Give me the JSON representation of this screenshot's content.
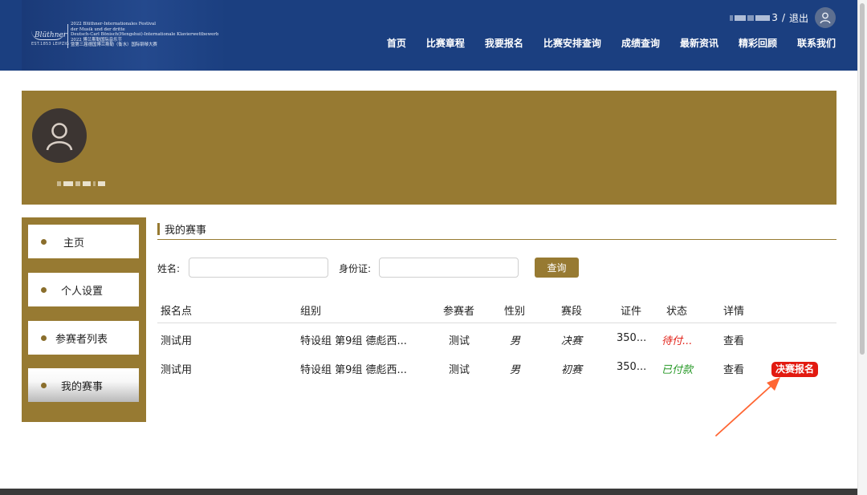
{
  "header": {
    "logo_mark": "Blüthner",
    "logo_sub": "EST.1853 LEIPZIG",
    "logo_lines": [
      "2022 Blüthner-Internationales Festival",
      "der Musik und der dritte",
      "Deutsch-Carl Bönisch(Hengshui)-Internationale Klavierwettbewerb",
      "2022 博兰斯勒国际音乐节",
      "暨第三届德国博兰斯勒（衡水）国际钢琴大赛"
    ],
    "user_suffix": "3",
    "user_sep": "/",
    "logout_label": "退出",
    "nav": [
      "首页",
      "比赛章程",
      "我要报名",
      "比赛安排查询",
      "成绩查询",
      "最新资讯",
      "精彩回顾",
      "联系我们"
    ]
  },
  "sidebar": {
    "items": [
      {
        "label": "主页"
      },
      {
        "label": "个人设置"
      },
      {
        "label": "参赛者列表"
      },
      {
        "label": "我的赛事"
      }
    ],
    "active_index": 3
  },
  "main": {
    "section_title": "我的赛事",
    "search": {
      "name_label": "姓名:",
      "name_value": "",
      "name_placeholder": "",
      "id_label": "身份证:",
      "id_value": "",
      "id_placeholder": "",
      "query_label": "查询"
    },
    "table": {
      "headers": [
        "报名点",
        "组别",
        "参赛者",
        "性别",
        "赛段",
        "证件",
        "状态",
        "详情"
      ],
      "rows": [
        {
          "site": "测试用",
          "group": "特设组 第9组 德彪西...",
          "participant": "测试",
          "gender": "男",
          "stage": "决赛",
          "cert": "350...",
          "status": "待付...",
          "status_type": "pending",
          "detail": "查看",
          "action": ""
        },
        {
          "site": "测试用",
          "group": "特设组 第9组 德彪西...",
          "participant": "测试",
          "gender": "男",
          "stage": "初赛",
          "cert": "350...",
          "status": "已付款",
          "status_type": "paid",
          "detail": "查看",
          "action": "决赛报名"
        }
      ]
    }
  },
  "colors": {
    "header_bg": "#1b3f80",
    "gold": "#977a32",
    "status_pending": "#e2231a",
    "status_paid": "#2a9a2a",
    "action_red": "#e21a10",
    "arrow": "#ff6633"
  },
  "icons": {
    "user_avatar": "user-icon",
    "profile_avatar": "user-icon",
    "bullet": "dot-icon",
    "annotation": "arrow-icon"
  }
}
